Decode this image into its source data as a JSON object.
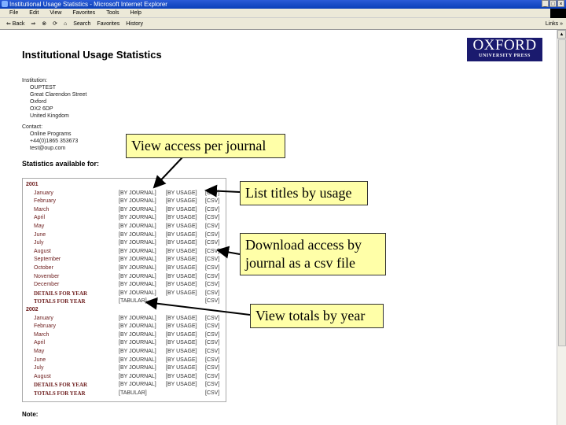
{
  "window": {
    "title": "Institutional Usage Statistics - Microsoft Internet Explorer",
    "min": "_",
    "max": "□",
    "close": "×"
  },
  "menu": [
    "File",
    "Edit",
    "View",
    "Favorites",
    "Tools",
    "Help"
  ],
  "toolbar": {
    "back": "⇐ Back",
    "forward": "⇒",
    "stop": "⊗",
    "refresh": "⟳",
    "home": "⌂",
    "search": "Search",
    "favorites": "Favorites",
    "history": "History",
    "links": "Links »"
  },
  "logo": {
    "line1": "OXFORD",
    "line2": "UNIVERSITY PRESS"
  },
  "page": {
    "title": "Institutional Usage Statistics",
    "institution_label": "Institution:",
    "institution": [
      "OUPTEST",
      "Great Clarendon Street",
      "Oxford",
      "OX2 6DP",
      "United Kingdom"
    ],
    "contact_label": "Contact:",
    "contact": [
      "Online Programs",
      "+44(0)1865 353673",
      "test@oup.com"
    ],
    "stats_heading": "Statistics available for:",
    "years": [
      {
        "year": "2001",
        "rows": [
          {
            "m": "January",
            "b": "[BY JOURNAL]",
            "u": "[BY USAGE]",
            "c": "[CSV]"
          },
          {
            "m": "February",
            "b": "[BY JOURNAL]",
            "u": "[BY USAGE]",
            "c": "[CSV]"
          },
          {
            "m": "March",
            "b": "[BY JOURNAL]",
            "u": "[BY USAGE]",
            "c": "[CSV]"
          },
          {
            "m": "April",
            "b": "[BY JOURNAL]",
            "u": "[BY USAGE]",
            "c": "[CSV]"
          },
          {
            "m": "May",
            "b": "[BY JOURNAL]",
            "u": "[BY USAGE]",
            "c": "[CSV]"
          },
          {
            "m": "June",
            "b": "[BY JOURNAL]",
            "u": "[BY USAGE]",
            "c": "[CSV]"
          },
          {
            "m": "July",
            "b": "[BY JOURNAL]",
            "u": "[BY USAGE]",
            "c": "[CSV]"
          },
          {
            "m": "August",
            "b": "[BY JOURNAL]",
            "u": "[BY USAGE]",
            "c": "[CSV]"
          },
          {
            "m": "September",
            "b": "[BY JOURNAL]",
            "u": "[BY USAGE]",
            "c": "[CSV]"
          },
          {
            "m": "October",
            "b": "[BY JOURNAL]",
            "u": "[BY USAGE]",
            "c": "[CSV]"
          },
          {
            "m": "November",
            "b": "[BY JOURNAL]",
            "u": "[BY USAGE]",
            "c": "[CSV]"
          },
          {
            "m": "December",
            "b": "[BY JOURNAL]",
            "u": "[BY USAGE]",
            "c": "[CSV]"
          },
          {
            "m": "DETAILS FOR YEAR",
            "b": "[BY JOURNAL]",
            "u": "[BY USAGE]",
            "c": "[CSV]",
            "bold": true
          },
          {
            "m": "TOTALS FOR YEAR",
            "b": "[TABULAR]",
            "u": "",
            "c": "[CSV]",
            "bold": true
          }
        ]
      },
      {
        "year": "2002",
        "rows": [
          {
            "m": "January",
            "b": "[BY JOURNAL]",
            "u": "[BY USAGE]",
            "c": "[CSV]"
          },
          {
            "m": "February",
            "b": "[BY JOURNAL]",
            "u": "[BY USAGE]",
            "c": "[CSV]"
          },
          {
            "m": "March",
            "b": "[BY JOURNAL]",
            "u": "[BY USAGE]",
            "c": "[CSV]"
          },
          {
            "m": "April",
            "b": "[BY JOURNAL]",
            "u": "[BY USAGE]",
            "c": "[CSV]"
          },
          {
            "m": "May",
            "b": "[BY JOURNAL]",
            "u": "[BY USAGE]",
            "c": "[CSV]"
          },
          {
            "m": "June",
            "b": "[BY JOURNAL]",
            "u": "[BY USAGE]",
            "c": "[CSV]"
          },
          {
            "m": "July",
            "b": "[BY JOURNAL]",
            "u": "[BY USAGE]",
            "c": "[CSV]"
          },
          {
            "m": "August",
            "b": "[BY JOURNAL]",
            "u": "[BY USAGE]",
            "c": "[CSV]"
          },
          {
            "m": "DETAILS FOR YEAR",
            "b": "[BY JOURNAL]",
            "u": "[BY USAGE]",
            "c": "[CSV]",
            "bold": true
          },
          {
            "m": "TOTALS FOR YEAR",
            "b": "[TABULAR]",
            "u": "",
            "c": "[CSV]",
            "bold": true
          }
        ]
      }
    ],
    "note_label": "Note:"
  },
  "callouts": {
    "journal": "View access per journal",
    "usage": "List titles by usage",
    "csv": "Download access by journal as a csv file",
    "totals": "View totals by year"
  }
}
